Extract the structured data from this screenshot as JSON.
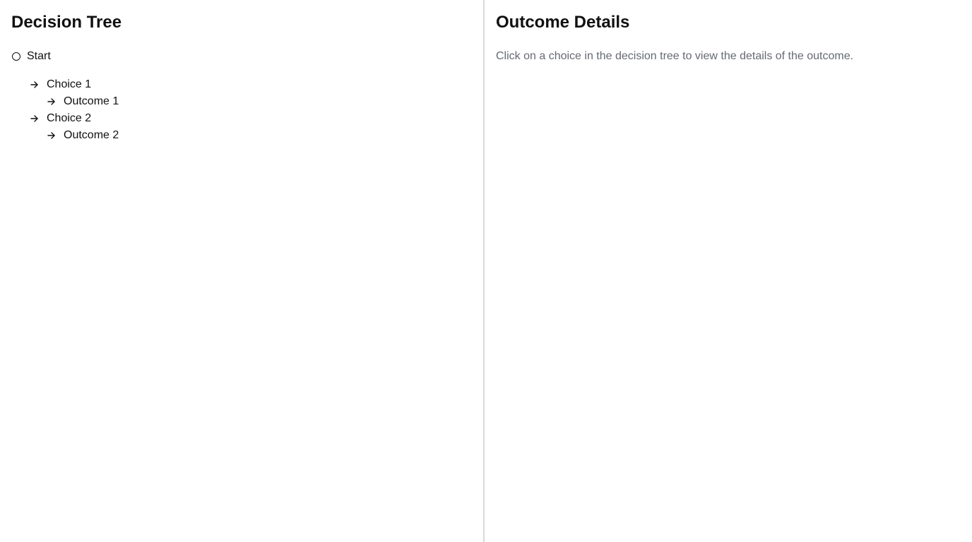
{
  "tree_panel": {
    "title": "Decision Tree",
    "root": {
      "label": "Start",
      "icon": "circle-icon"
    },
    "choices": [
      {
        "label": "Choice 1",
        "icon": "arrow-right-icon",
        "outcome": {
          "label": "Outcome 1",
          "icon": "arrow-right-icon"
        }
      },
      {
        "label": "Choice 2",
        "icon": "arrow-right-icon",
        "outcome": {
          "label": "Outcome 2",
          "icon": "arrow-right-icon"
        }
      }
    ]
  },
  "details_panel": {
    "title": "Outcome Details",
    "placeholder": "Click on a choice in the decision tree to view the details of the outcome."
  },
  "colors": {
    "text": "#111111",
    "muted_text": "#666a70",
    "divider": "#d9d9d9",
    "background": "#ffffff"
  }
}
